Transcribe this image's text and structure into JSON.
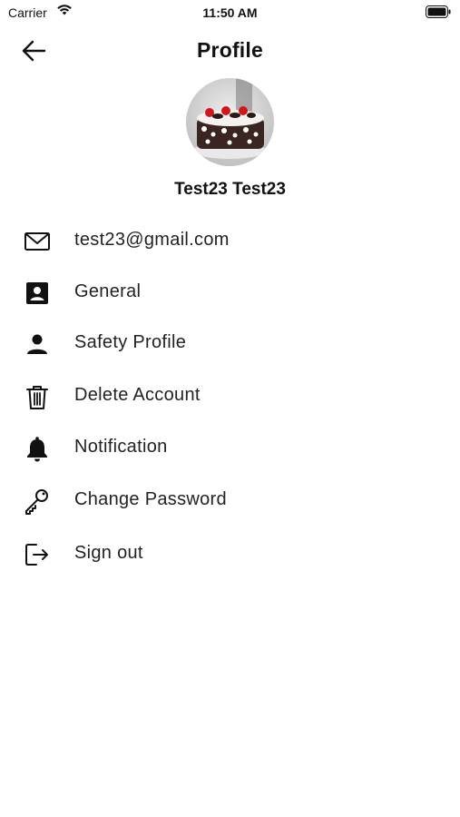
{
  "status_bar": {
    "carrier": "Carrier",
    "time": "11:50 AM"
  },
  "header": {
    "title": "Profile"
  },
  "user": {
    "name": "Test23 Test23"
  },
  "menu": {
    "items": [
      {
        "label": "test23@gmail.com",
        "icon": "mail-icon"
      },
      {
        "label": "General",
        "icon": "contact-card-icon"
      },
      {
        "label": "Safety Profile",
        "icon": "person-icon"
      },
      {
        "label": "Delete Account",
        "icon": "trash-icon"
      },
      {
        "label": "Notification",
        "icon": "bell-icon"
      },
      {
        "label": "Change Password",
        "icon": "key-icon"
      },
      {
        "label": "Sign out",
        "icon": "logout-icon"
      }
    ]
  }
}
